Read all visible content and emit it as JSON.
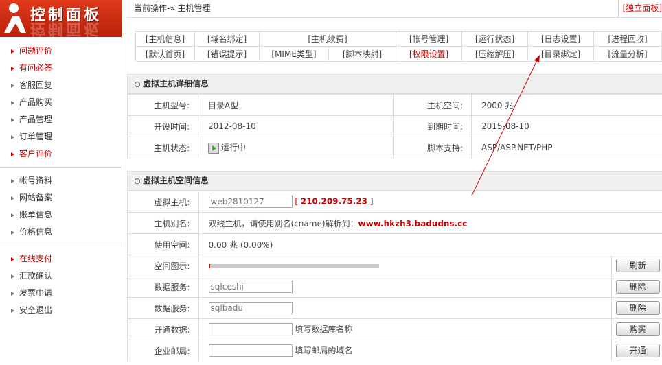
{
  "logo": {
    "title": "控制面板"
  },
  "sidebar": {
    "group1": [
      {
        "label": "问题评价",
        "red": true
      },
      {
        "label": "有问必答",
        "red": true
      },
      {
        "label": "客服回复",
        "red": false
      },
      {
        "label": "产品购买",
        "red": false
      },
      {
        "label": "产品管理",
        "red": false
      },
      {
        "label": "订单管理",
        "red": false
      },
      {
        "label": "客户评价",
        "red": true
      }
    ],
    "group2": [
      {
        "label": "帐号资料",
        "red": false
      },
      {
        "label": "网站备案",
        "red": false
      },
      {
        "label": "账单信息",
        "red": false
      },
      {
        "label": "价格信息",
        "red": false
      }
    ],
    "group3": [
      {
        "label": "在线支付",
        "red": true
      },
      {
        "label": "汇款确认",
        "red": false
      },
      {
        "label": "发票申请",
        "red": false
      },
      {
        "label": "安全退出",
        "red": false
      }
    ]
  },
  "breadcrumb": {
    "text": "当前操作-» 主机管理",
    "right_link": "[独立面板]"
  },
  "topnav": {
    "row1": [
      "[主机信息]",
      "[域名绑定]",
      "[主机续费]",
      "[帐号管理]",
      "[运行状态]",
      "[日志设置]",
      "[进程回收]"
    ],
    "row2": [
      "[默认首页]",
      "[错误提示]",
      "[MIME类型]",
      "[脚本映射]",
      "[权限设置]",
      "[压缩解压]",
      "[目录绑定]",
      "[流量分析]"
    ]
  },
  "detail": {
    "title": "虚拟主机详细信息",
    "type_label": "主机型号:",
    "type_value": "目录A型",
    "space_label": "主机空间:",
    "space_value": "2000 兆",
    "open_label": "开设时间:",
    "open_value": "2012-08-10",
    "expire_label": "到期时间:",
    "expire_value": "2015-08-10",
    "status_label": "主机状态:",
    "status_value": "运行中",
    "script_label": "脚本支持:",
    "script_value": "ASP/ASP.NET/PHP"
  },
  "space": {
    "title": "虚拟主机空间信息",
    "host_label": "虚拟主机:",
    "host_value": "web2810127",
    "ip_open": "[",
    "ip": "210.209.75.23",
    "ip_close": "]",
    "alias_label": "主机别名:",
    "alias_text": "双线主机，请使用别名(cname)解析到：",
    "alias_domain": "www.hkzh3.badudns.cc",
    "used_label": "使用空间:",
    "used_value": "0.00 兆  (0.00%)",
    "used_fraction": 0.0,
    "graph_label": "空间图示:",
    "refresh_button": "刷新",
    "db1_label": "数据服务:",
    "db1_value": "sqlceshi",
    "db1_button": "删除",
    "db2_label": "数据服务:",
    "db2_value": "sqlbadu",
    "db2_button": "删除",
    "newdb_label": "开通数据:",
    "newdb_hint": "填写数据库名称",
    "newdb_button": "购买",
    "mail_label": "企业邮局:",
    "mail_hint": "填写邮局的域名",
    "mail_button": "开通"
  }
}
